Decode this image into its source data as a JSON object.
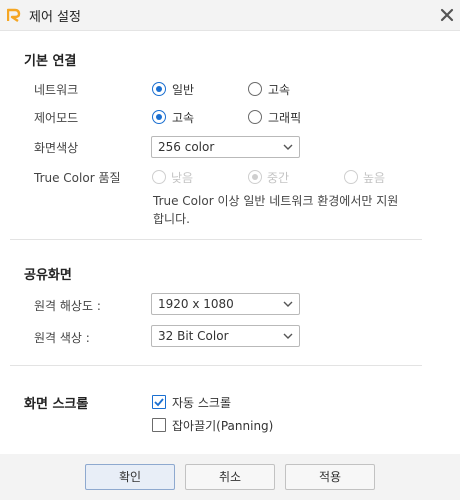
{
  "window": {
    "title": "제어 설정",
    "close_icon": "close-icon"
  },
  "basic": {
    "title": "기본 연결",
    "network": {
      "label": "네트워크",
      "options": [
        "일반",
        "고속"
      ],
      "selected": "일반"
    },
    "control_mode": {
      "label": "제어모드",
      "options": [
        "고속",
        "그래픽"
      ],
      "selected": "고속"
    },
    "screen_color": {
      "label": "화면색상",
      "value": "256 color"
    },
    "true_color_quality": {
      "label": "True  Color 품질",
      "options": [
        "낮음",
        "중간",
        "높음"
      ],
      "selected": "중간",
      "disabled": true
    },
    "note_line1": "True  Color 이상 일반 네트워크 환경에서만 지원",
    "note_line2": "합니다."
  },
  "shared": {
    "title": "공유화면",
    "remote_resolution": {
      "label": "원격 해상도 :",
      "value": "1920 x 1080"
    },
    "remote_color": {
      "label": "원격 색상 :",
      "value": "32 Bit Color"
    }
  },
  "scroll": {
    "title": "화면 스크롤",
    "auto_scroll": {
      "label": "자동 스크롤",
      "checked": true
    },
    "panning": {
      "label": "잡아끌기(Panning)",
      "checked": false
    }
  },
  "buttons": {
    "ok": "확인",
    "cancel": "취소",
    "apply": "적용"
  },
  "colors": {
    "accent": "#1a6fd1",
    "logo": "#f5a623"
  }
}
